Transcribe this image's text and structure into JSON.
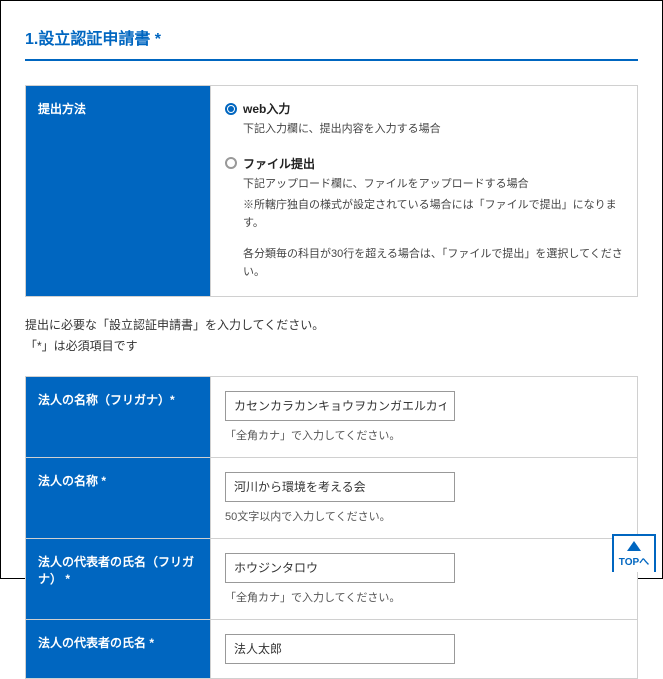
{
  "section": {
    "title": "1.設立認証申請書 *"
  },
  "method": {
    "label": "提出方法",
    "options": {
      "web": {
        "label": "web入力",
        "desc": "下記入力欄に、提出内容を入力する場合"
      },
      "file": {
        "label": "ファイル提出",
        "desc1": "下記アップロード欄に、ファイルをアップロードする場合",
        "desc2": "※所轄庁独自の様式が設定されている場合には「ファイルで提出」になります。",
        "desc3": "各分類毎の科目が30行を超える場合は、「ファイルで提出」を選択してください。"
      }
    }
  },
  "instruction": {
    "line1": "提出に必要な「設立認証申請書」を入力してください。",
    "line2": "「*」は必須項目です"
  },
  "fields": {
    "name_furigana": {
      "label": "法人の名称（フリガナ）*",
      "value": "カセンカラカンキョウヲカンガエルカイ",
      "hint": "「全角カナ」で入力してください。"
    },
    "name": {
      "label": "法人の名称 *",
      "value": "河川から環境を考える会",
      "hint": "50文字以内で入力してください。"
    },
    "rep_furigana": {
      "label": "法人の代表者の氏名（フリガナ） *",
      "value": "ホウジンタロウ",
      "hint": "「全角カナ」で入力してください。"
    },
    "rep_name": {
      "label": "法人の代表者の氏名 *",
      "value": "法人太郎"
    }
  },
  "top_button": {
    "label": "TOPへ"
  }
}
